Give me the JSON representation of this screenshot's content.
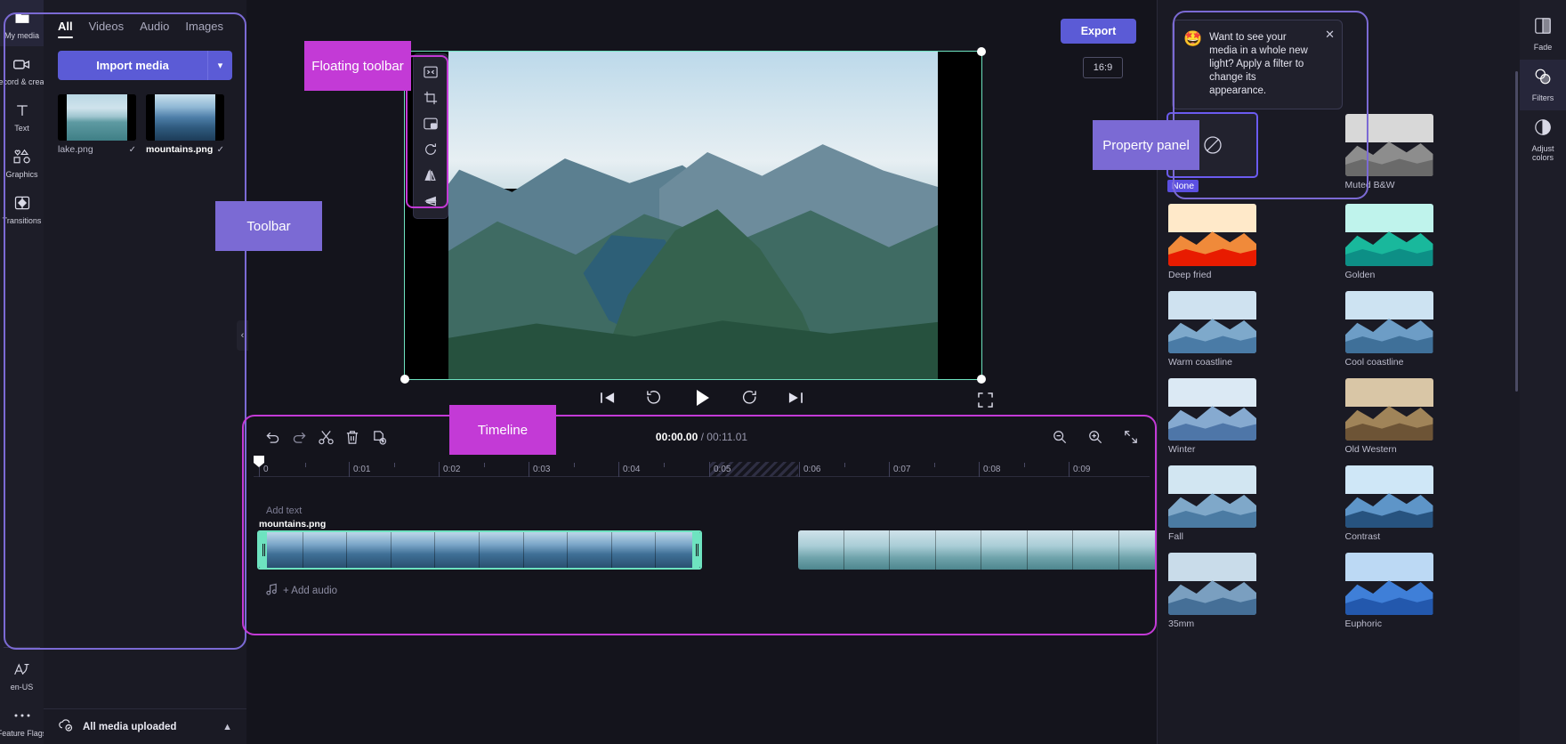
{
  "left_rail": {
    "items": [
      {
        "label": "My media",
        "icon": "folder-icon",
        "active": true
      },
      {
        "label": "Record & create",
        "icon": "camera-icon",
        "active": false
      },
      {
        "label": "Text",
        "icon": "text-icon",
        "active": false
      },
      {
        "label": "Graphics",
        "icon": "shapes-icon",
        "active": false
      },
      {
        "label": "Transitions",
        "icon": "transitions-icon",
        "active": false
      }
    ],
    "bottom_items": [
      {
        "label": "en-US",
        "icon": "language-icon"
      },
      {
        "label": "Feature Flags",
        "icon": "ellipsis-icon"
      }
    ]
  },
  "media_panel": {
    "tabs": [
      {
        "label": "All",
        "active": true
      },
      {
        "label": "Videos",
        "active": false
      },
      {
        "label": "Audio",
        "active": false
      },
      {
        "label": "Images",
        "active": false
      }
    ],
    "import_label": "Import media",
    "import_caret_icon": "chevron-down-icon",
    "items": [
      {
        "name": "lake.png",
        "selected": false,
        "check_icon": "check-icon"
      },
      {
        "name": "mountains.png",
        "selected": true,
        "check_icon": "check-icon"
      }
    ],
    "upload_status": "All media uploaded",
    "upload_icon": "cloud-check-icon",
    "upload_caret_icon": "chevron-up-icon"
  },
  "stage": {
    "export_label": "Export",
    "aspect_ratio": "16:9",
    "floating_toolbar": [
      {
        "name": "fit-to-frame-icon",
        "title": "Fit"
      },
      {
        "name": "crop-icon",
        "title": "Crop"
      },
      {
        "name": "picture-in-picture-icon",
        "title": "Picture in picture"
      },
      {
        "name": "rotate-icon",
        "title": "Rotate"
      },
      {
        "name": "flip-horizontal-icon",
        "title": "Flip horizontal"
      },
      {
        "name": "flip-vertical-icon",
        "title": "Flip vertical"
      }
    ],
    "transport": [
      {
        "name": "skip-previous-icon"
      },
      {
        "name": "rewind-5s-icon"
      },
      {
        "name": "play-icon"
      },
      {
        "name": "forward-5s-icon"
      },
      {
        "name": "skip-next-icon"
      }
    ],
    "fullscreen_icon": "fullscreen-icon",
    "collapse_left_icon": "chevron-left-icon",
    "collapse_right_icon": "chevron-right-icon",
    "help_icon": "chat-help-icon"
  },
  "timeline": {
    "tools": [
      {
        "name": "undo-icon"
      },
      {
        "name": "redo-icon"
      },
      {
        "name": "split-icon"
      },
      {
        "name": "delete-icon"
      },
      {
        "name": "duplicate-icon"
      }
    ],
    "current_time": "00:00.00",
    "separator": " / ",
    "total_time": "00:11.01",
    "zoom_out_icon": "zoom-out-icon",
    "zoom_in_icon": "zoom-in-icon",
    "fit_icon": "fit-timeline-icon",
    "ruler_ticks": [
      "0",
      "0:01",
      "0:02",
      "0:03",
      "0:04",
      "0:05",
      "0:06",
      "0:07",
      "0:08",
      "0:09"
    ],
    "text_track_label": "Add text",
    "clips": [
      {
        "label": "mountains.png",
        "selected": true
      },
      {
        "label": "",
        "selected": false
      }
    ],
    "audio_track_label": "+ Add audio",
    "audio_icon": "music-note-icon"
  },
  "property_panel": {
    "coach_mark": {
      "emoji": "🤩",
      "text": "Want to see your media in a whole new light? Apply a filter to change its appearance.",
      "close_icon": "close-icon"
    },
    "filters": [
      {
        "name": "None",
        "selected": true,
        "icon": "no-filter-icon",
        "sky": "#22222e",
        "mid": "#22222e",
        "fore": "#22222e"
      },
      {
        "name": "Muted B&W",
        "selected": false,
        "sky": "#d8d8d8",
        "mid": "#8d8d8d",
        "fore": "#6a6a6a"
      },
      {
        "name": "Deep fried",
        "selected": false,
        "sky": "#ffe9c9",
        "mid": "#f08a3a",
        "fore": "#e81b00"
      },
      {
        "name": "Golden",
        "selected": false,
        "sky": "#bff3ec",
        "mid": "#19b89c",
        "fore": "#0d8f86"
      },
      {
        "name": "Warm coastline",
        "selected": false,
        "sky": "#cfe2f0",
        "mid": "#7ea9cb",
        "fore": "#4a7ba6"
      },
      {
        "name": "Cool coastline",
        "selected": false,
        "sky": "#cde3f2",
        "mid": "#6d9dc6",
        "fore": "#3f7099"
      },
      {
        "name": "Winter",
        "selected": false,
        "sky": "#dbe9f4",
        "mid": "#86aad0",
        "fore": "#4e76a8"
      },
      {
        "name": "Old Western",
        "selected": false,
        "sky": "#d9c6a6",
        "mid": "#a08459",
        "fore": "#6d5436"
      },
      {
        "name": "Fall",
        "selected": false,
        "sky": "#d2e6f2",
        "mid": "#7fa8c9",
        "fore": "#4b7ba3"
      },
      {
        "name": "Contrast",
        "selected": false,
        "sky": "#cfe7f7",
        "mid": "#5e95c8",
        "fore": "#27537f"
      },
      {
        "name": "35mm",
        "selected": false,
        "sky": "#c9dcea",
        "mid": "#7a9fc0",
        "fore": "#456f97"
      },
      {
        "name": "Euphoric",
        "selected": false,
        "sky": "#bcd9f4",
        "mid": "#3f7fd8",
        "fore": "#2358ad"
      }
    ]
  },
  "right_rail": {
    "items": [
      {
        "label": "Fade",
        "icon": "fade-icon",
        "active": false
      },
      {
        "label": "Filters",
        "icon": "filters-icon",
        "active": true
      },
      {
        "label": "Adjust colors",
        "icon": "adjust-colors-icon",
        "active": false
      }
    ]
  },
  "callouts": [
    {
      "id": "floating-toolbar",
      "text": "Floating toolbar",
      "color": "#c33ad6"
    },
    {
      "id": "toolbar",
      "text": "Toolbar",
      "color": "#7b6ad4"
    },
    {
      "id": "timeline",
      "text": "Timeline",
      "color": "#c33ad6"
    },
    {
      "id": "property-panel",
      "text": "Property panel",
      "color": "#7b6ad4"
    }
  ],
  "colors": {
    "accent": "#5b5bd6",
    "callout_magenta": "#c33ad6",
    "callout_purple": "#7b6ad4",
    "selection_teal": "#6ee3c0"
  }
}
